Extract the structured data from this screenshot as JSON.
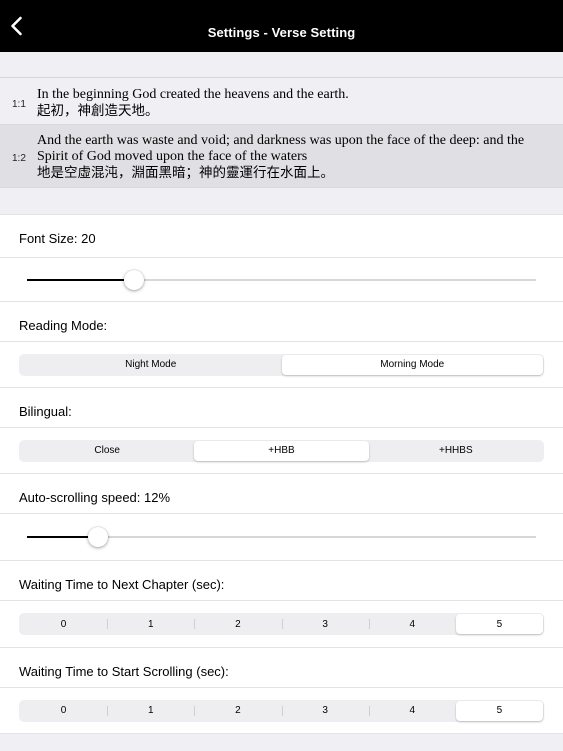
{
  "nav": {
    "title": "Settings - Verse Setting",
    "back_icon": "chevron-left-icon"
  },
  "verses": [
    {
      "num": "1:1",
      "en": "In the beginning God created the heavens and the earth.",
      "zh": "起初，神創造天地。"
    },
    {
      "num": "1:2",
      "en": "And the earth was waste and void; and darkness was upon the face of the deep: and the Spirit of God moved upon the face of the waters",
      "zh": "地是空虛混沌，淵面黑暗；神的靈運行在水面上。"
    }
  ],
  "font_size": {
    "label": "Font Size: 20",
    "fraction": 0.21
  },
  "reading_mode": {
    "label": "Reading Mode:",
    "options": [
      "Night Mode",
      "Morning Mode"
    ],
    "selected": 1
  },
  "bilingual": {
    "label": "Bilingual:",
    "options": [
      "Close",
      "+HBB",
      "+HHBS"
    ],
    "selected": 1
  },
  "auto_scroll": {
    "label": "Auto-scrolling speed: 12%",
    "fraction": 0.139
  },
  "wait_next_chapter": {
    "label": "Waiting Time to Next Chapter (sec):",
    "options": [
      "0",
      "1",
      "2",
      "3",
      "4",
      "5"
    ],
    "selected": 5
  },
  "wait_start_scroll": {
    "label": "Waiting Time to Start Scrolling (sec):",
    "options": [
      "0",
      "1",
      "2",
      "3",
      "4",
      "5"
    ],
    "selected": 5
  }
}
